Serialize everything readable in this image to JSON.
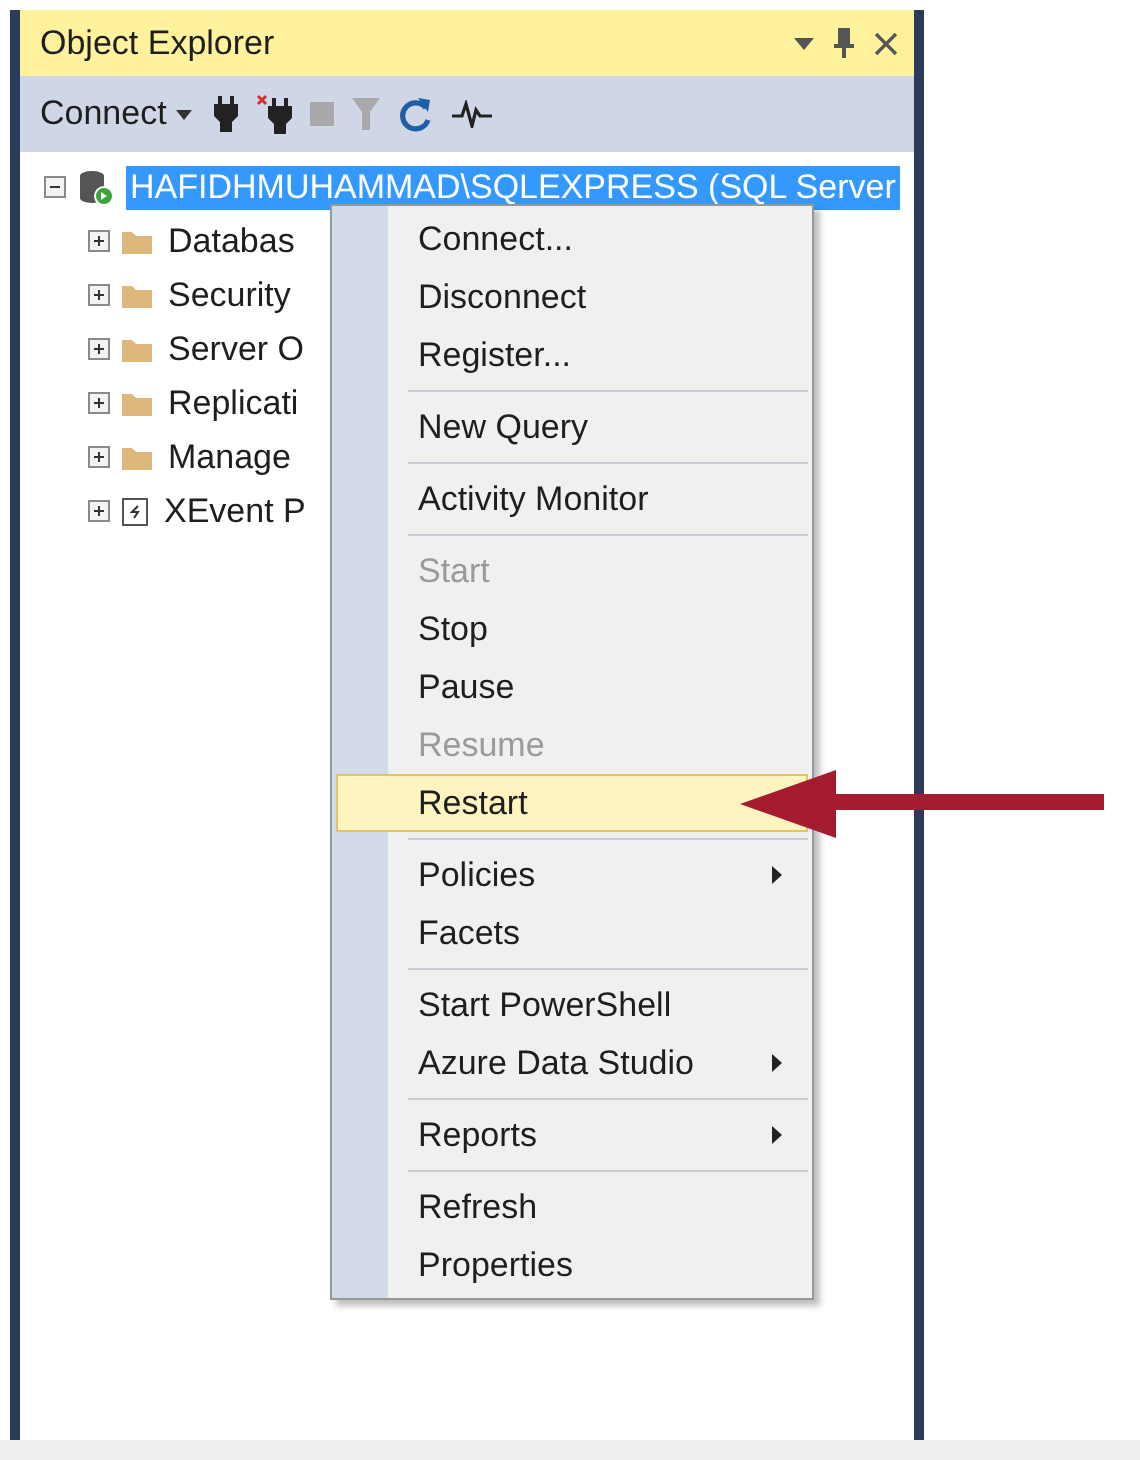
{
  "panel": {
    "title": "Object Explorer",
    "header_icons": [
      {
        "kind": "dropdown"
      },
      {
        "kind": "pin"
      },
      {
        "kind": "close"
      }
    ]
  },
  "toolbar": {
    "connect": {
      "label": "Connect"
    },
    "buttons": [
      {
        "kind": "plug",
        "disabled": false
      },
      {
        "kind": "disconnect",
        "disabled": false
      },
      {
        "kind": "stop",
        "disabled": true
      },
      {
        "kind": "filter",
        "disabled": true
      },
      {
        "kind": "refresh",
        "disabled": false
      },
      {
        "kind": "activity",
        "disabled": false
      }
    ]
  },
  "tree": {
    "label": "HAFIDHMUHAMMAD\\SQLEXPRESS (SQL Server",
    "expanded": true,
    "selected": true,
    "children": [
      {
        "label": "Databas",
        "kind": "folder",
        "expanded": false,
        "selected": false
      },
      {
        "label": "Security",
        "kind": "folder",
        "expanded": false,
        "selected": false
      },
      {
        "label": "Server O",
        "kind": "folder",
        "expanded": false,
        "selected": false
      },
      {
        "label": "Replicati",
        "kind": "folder",
        "expanded": false,
        "selected": false
      },
      {
        "label": "Manage",
        "kind": "folder",
        "expanded": false,
        "selected": false
      },
      {
        "label": "XEvent P",
        "kind": "xevent",
        "expanded": false,
        "selected": false
      }
    ]
  },
  "context_menu": {
    "groups": [
      [
        {
          "label": "Connect...",
          "disabled": false,
          "selected": false,
          "submenu": false
        },
        {
          "label": "Disconnect",
          "disabled": false,
          "selected": false,
          "submenu": false
        },
        {
          "label": "Register...",
          "disabled": false,
          "selected": false,
          "submenu": false
        }
      ],
      [
        {
          "label": "New Query",
          "disabled": false,
          "selected": false,
          "submenu": false
        }
      ],
      [
        {
          "label": "Activity Monitor",
          "disabled": false,
          "selected": false,
          "submenu": false
        }
      ],
      [
        {
          "label": "Start",
          "disabled": true,
          "selected": false,
          "submenu": false
        },
        {
          "label": "Stop",
          "disabled": false,
          "selected": false,
          "submenu": false
        },
        {
          "label": "Pause",
          "disabled": false,
          "selected": false,
          "submenu": false
        },
        {
          "label": "Resume",
          "disabled": true,
          "selected": false,
          "submenu": false
        },
        {
          "label": "Restart",
          "disabled": false,
          "selected": true,
          "submenu": false
        }
      ],
      [
        {
          "label": "Policies",
          "disabled": false,
          "selected": false,
          "submenu": true
        },
        {
          "label": "Facets",
          "disabled": false,
          "selected": false,
          "submenu": false
        }
      ],
      [
        {
          "label": "Start PowerShell",
          "disabled": false,
          "selected": false,
          "submenu": false
        },
        {
          "label": "Azure Data Studio",
          "disabled": false,
          "selected": false,
          "submenu": true
        }
      ],
      [
        {
          "label": "Reports",
          "disabled": false,
          "selected": false,
          "submenu": true
        }
      ],
      [
        {
          "label": "Refresh",
          "disabled": false,
          "selected": false,
          "submenu": false
        },
        {
          "label": "Properties",
          "disabled": false,
          "selected": false,
          "submenu": false
        }
      ]
    ]
  },
  "annotation": {
    "kind": "arrow"
  }
}
